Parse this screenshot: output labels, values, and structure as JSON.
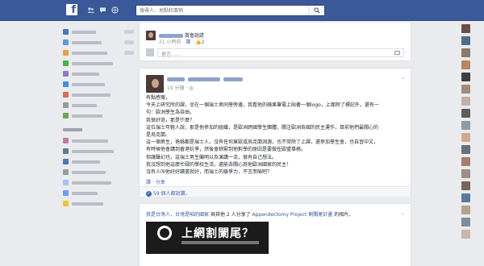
{
  "topbar": {
    "logo": "f",
    "search_placeholder": "搜尋人、地點和事物",
    "icons": [
      "friends-icon",
      "messages-icon",
      "globe-icon"
    ]
  },
  "comment_card": {
    "name_suffix": "賞會說謊",
    "time": "21 小時前",
    "like_label": "讚",
    "like_count": "2",
    "reply_placeholder": "留言……",
    "colors": {
      "link": "#4267b2"
    }
  },
  "post": {
    "time": "19 分鐘",
    "lines": [
      "有點感慨，",
      "今天上研究所的課，坐在一個瑞士男同學旁邊，我看他的蘋果筆電上貼著一個logo，上面除了標記外，還有一",
      "句：歐洲學生為自由。",
      "我很好奇，那是什麼？",
      "這位瑞士年輕人說，那是他參加的組織，是歐洲跨國學生團體，關注歐洲各國的民主運作，目前他們最關心的",
      "是烏克蘭。",
      "這一個男生，爸媽都是瑞士人，沒有任何東歐或烏克蘭淵源，也不常除了上課，還參加學生會，也自習中文，",
      "有時候他會講到香港抗爭，然後會餘緊到他對學的原因是要做任歐盟事務。",
      "但讓聲幻也，這瑞士男生顯明以及演講一流，很有自己想法。",
      "我沒想到他這麼忙碌的學校生活，還能去關心其他歐洲國家的民主！",
      "沒有人叫他好好讀書就好，而瑞士的競爭力，不言而喻吧？"
    ],
    "actions": "讚 · 分享",
    "likes_text": "59 個人都說讚。"
  },
  "shared_post": {
    "name": "我是台灣人，台灣是咱的國家",
    "middle": "與其他 2 人分享了 ",
    "page": "Appendectomy Project 割闌尾計畫",
    "suffix": "的相片。",
    "banner_title": "上網割闌尾？"
  },
  "left_nav": {
    "icon_colors": [
      "#4a76b9",
      "#5b9bd5",
      "#e7a13b",
      "#4caf50",
      "#8e7cc3",
      "#3f8fd2",
      "#d96b59",
      "#999999",
      "#6aa84f",
      "#c27ba0",
      "#5f7d95",
      "#4a76b9",
      "#999999",
      "#a4c2f4",
      "#6d9eeb",
      "#f1c232"
    ]
  },
  "chat_colors": [
    "#6c5048",
    "#4f6d8a",
    "#8c7a6b",
    "#b8845e",
    "#3e3e3e",
    "#a0897a",
    "#c2b0a4",
    "#5b5b5b",
    "#8e9aa6",
    "#d1a88b",
    "#666f7a",
    "#a67c6d",
    "#9a8e86",
    "#7a6258",
    "#5a7a9a",
    "#b5a190",
    "#7f8b96",
    "#c9b6a8"
  ]
}
